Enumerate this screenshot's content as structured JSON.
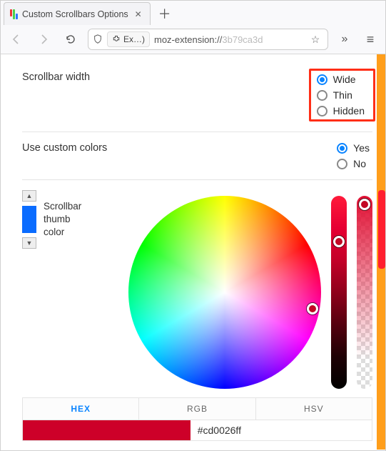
{
  "browser": {
    "tab_title": "Custom Scrollbars Options",
    "ext_chip": "Ex…)",
    "url_prefix": "moz-extension://",
    "url_suffix": "3b79ca3d"
  },
  "settings": {
    "width": {
      "label": "Scrollbar width",
      "options": [
        "Wide",
        "Thin",
        "Hidden"
      ],
      "selected": 0
    },
    "custom_colors": {
      "label": "Use custom colors",
      "options": [
        "Yes",
        "No"
      ],
      "selected": 0
    },
    "thumb_color": {
      "label_line1": "Scrollbar",
      "label_line2": "thumb",
      "label_line3": "color"
    }
  },
  "color_modes": [
    "HEX",
    "RGB",
    "HSV"
  ],
  "active_mode": 0,
  "color_value": "#cd0026ff"
}
